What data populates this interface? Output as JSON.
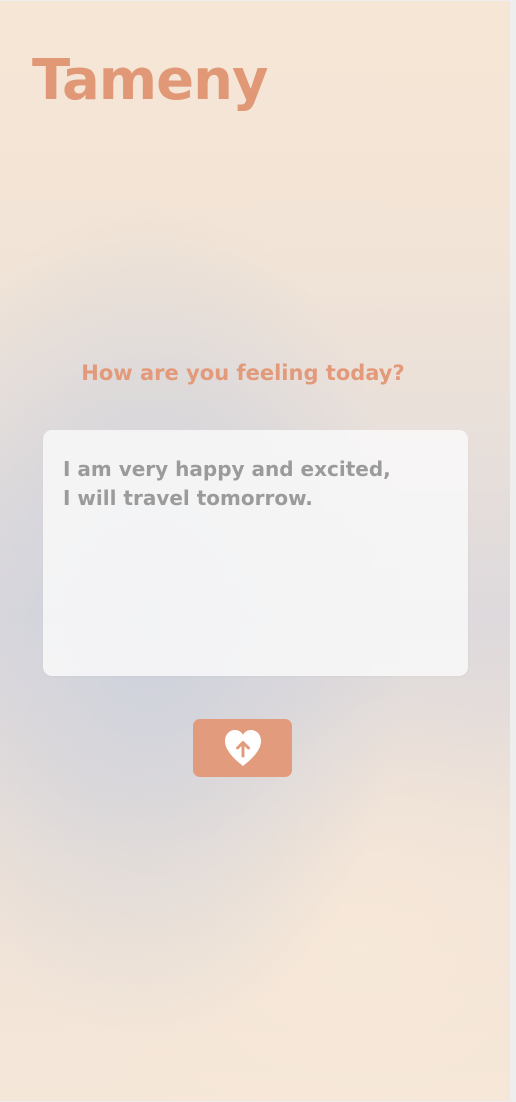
{
  "app": {
    "title": "Tameny"
  },
  "prompt": {
    "text": "How are you feeling today?"
  },
  "entry": {
    "value": "I am very happy and excited,\nI will travel tomorrow."
  },
  "submit": {
    "icon": "heart-upload-icon"
  },
  "colors": {
    "accent": "#e29c7d",
    "text_muted": "#9b9b9b"
  }
}
